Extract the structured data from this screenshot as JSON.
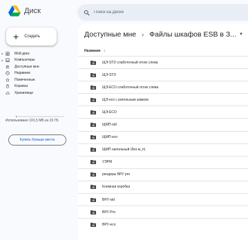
{
  "app": {
    "title": "Диск"
  },
  "search": {
    "placeholder": "Поиск на Диске"
  },
  "sidebar": {
    "create_label": "Создать",
    "items": [
      {
        "label": "Мой диск",
        "icon": "my-drive-icon",
        "caret": true
      },
      {
        "label": "Компьютеры",
        "icon": "computer-icon",
        "caret": true
      },
      {
        "label": "Доступные мне",
        "icon": "shared-icon",
        "caret": false
      },
      {
        "label": "Недавние",
        "icon": "clock-icon",
        "caret": false
      },
      {
        "label": "Помеченные",
        "icon": "star-icon",
        "caret": false
      },
      {
        "label": "Корзина",
        "icon": "trash-icon",
        "caret": false
      },
      {
        "label": "Хранилище",
        "icon": "cloud-icon",
        "caret": false
      }
    ],
    "storage_text": "Использовано 101,5 МБ из 15 ГБ",
    "storage_fraction": 0.01,
    "buy_label": "Купить больше места"
  },
  "main": {
    "breadcrumb": [
      "Доступные мне",
      "Файлы шкафов ESB в З..."
    ],
    "column_name": "Название",
    "sort_icon": "arrow-down-icon",
    "files": [
      "ЩЭ-STD слаботочный отсек слева",
      "ЩЭ-STD",
      "ЩЭ-ECO слаботочный отсек слева",
      "ЩЭ-eco с ригельным замком",
      "ЩЭ-ECO",
      "ЩМП-std",
      "ЩМП-eco",
      "ЩМП напольный (без м_п)",
      "УЭРМ",
      "рендеры ВРУ pro",
      "Клемная коробка",
      "ВРУ-std",
      "ВРУ-Pro",
      "ВРУ-eco"
    ]
  },
  "colors": {
    "accent": "#0b57d0",
    "background": "#f8fafd",
    "folder": "#444746"
  }
}
